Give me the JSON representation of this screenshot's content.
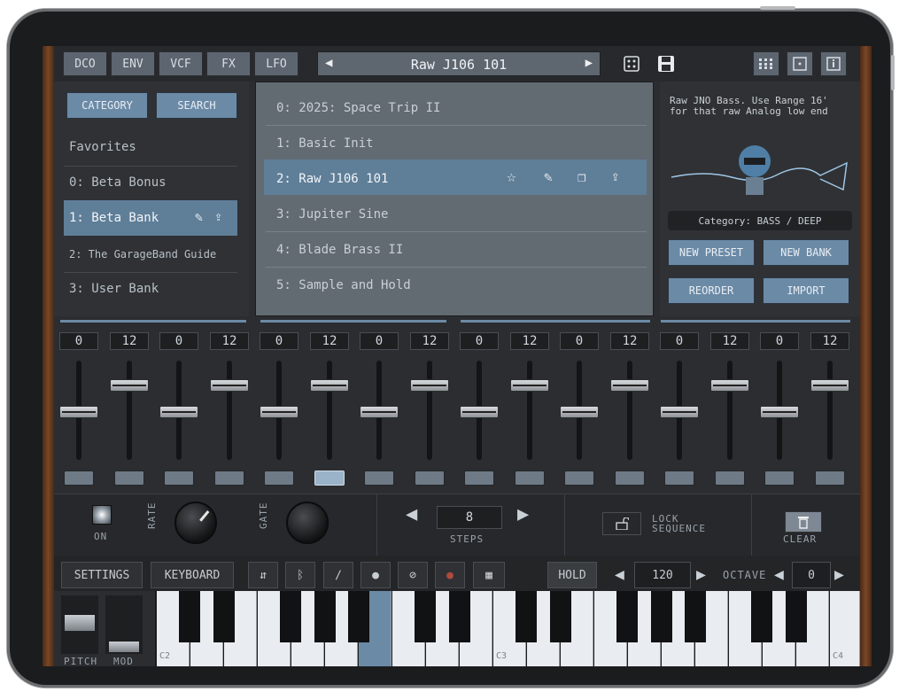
{
  "tabs": [
    "DCO",
    "ENV",
    "VCF",
    "FX",
    "LFO"
  ],
  "preset_title": "Raw J106 101",
  "left_panel": {
    "category_btn": "CATEGORY",
    "search_btn": "SEARCH",
    "items": [
      "Favorites",
      "0: Beta Bonus",
      "1: Beta Bank",
      "2: The GarageBand Guide",
      "3: User Bank"
    ],
    "selected_index": 2
  },
  "presets": [
    "0: 2025: Space Trip II",
    "1: Basic Init",
    "2: Raw J106 101",
    "3: Jupiter Sine",
    "4: Blade Brass II",
    "5: Sample and Hold"
  ],
  "selected_preset_index": 2,
  "info": {
    "description": "Raw JNO Bass. Use Range 16' for that raw Analog low end",
    "category": "Category: BASS / DEEP",
    "new_preset": "NEW PRESET",
    "new_bank": "NEW BANK",
    "reorder": "REORDER",
    "import": "IMPORT"
  },
  "step_values": [
    "0",
    "12",
    "0",
    "12",
    "0",
    "12",
    "0",
    "12",
    "0",
    "12",
    "0",
    "12",
    "0",
    "12",
    "0",
    "12"
  ],
  "sequencer": {
    "on": "ON",
    "rate": "RATE",
    "gate": "GATE",
    "steps_value": "8",
    "steps": "STEPS",
    "lock": "LOCK",
    "sequence": "SEQUENCE",
    "clear": "CLEAR"
  },
  "bottom": {
    "settings": "SETTINGS",
    "keyboard": "KEYBOARD",
    "hold": "HOLD",
    "tempo": "120",
    "octave_label": "OCTAVE",
    "octave": "0",
    "pitch": "PITCH",
    "mod": "MOD",
    "c2": "C2",
    "c3": "C3",
    "c4": "C4"
  },
  "colors": {
    "accent": "#6b8aa6",
    "selected_row": "#5f7e98",
    "background": "#2b2d30"
  }
}
